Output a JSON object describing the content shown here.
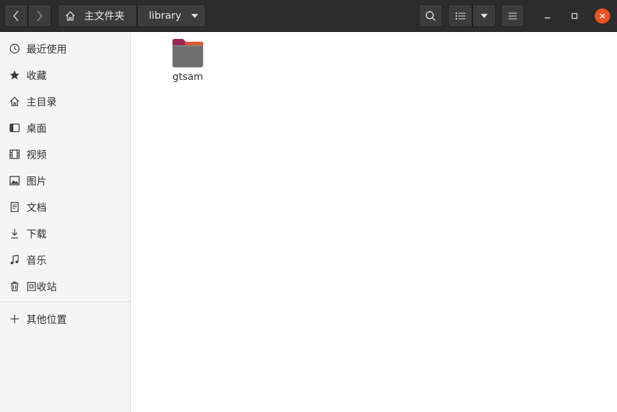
{
  "header": {
    "path_home_label": "主文件夹",
    "path_current_label": "library"
  },
  "sidebar": {
    "items": [
      {
        "label": "最近使用",
        "icon": "clock-icon"
      },
      {
        "label": "收藏",
        "icon": "star-icon"
      },
      {
        "label": "主目录",
        "icon": "home-icon"
      },
      {
        "label": "桌面",
        "icon": "desktop-icon"
      },
      {
        "label": "视频",
        "icon": "film-icon"
      },
      {
        "label": "图片",
        "icon": "image-icon"
      },
      {
        "label": "文档",
        "icon": "document-icon"
      },
      {
        "label": "下载",
        "icon": "download-icon"
      },
      {
        "label": "音乐",
        "icon": "music-icon"
      },
      {
        "label": "回收站",
        "icon": "trash-icon"
      }
    ],
    "other_locations": {
      "label": "其他位置",
      "icon": "plus-icon"
    }
  },
  "content": {
    "files": [
      {
        "name": "gtsam",
        "type": "folder"
      }
    ]
  },
  "colors": {
    "headerbar": "#2c2c2c",
    "close_button": "#e95420",
    "sidebar_bg": "#f5f5f5",
    "folder_body": "#6f6f6f",
    "folder_tab": "#9b2857"
  }
}
